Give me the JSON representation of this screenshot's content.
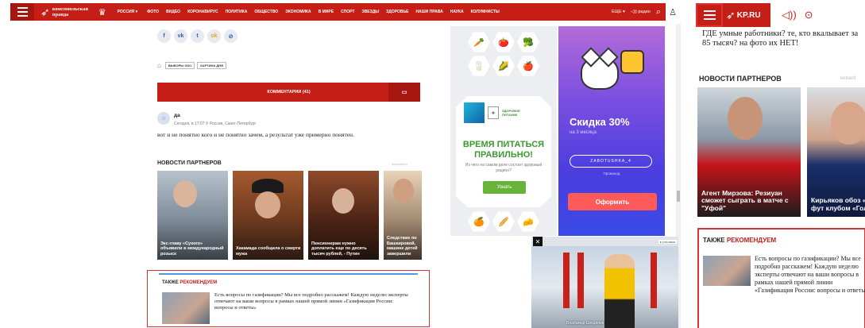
{
  "desktop": {
    "logo_text": "Комсомольская правда",
    "region": "РОССИЯ ▾",
    "nav": [
      "ФОТО",
      "ВИДЕО",
      "КОРОНАВИРУС",
      "ПОЛИТИКА",
      "ОБЩЕСТВО",
      "ЭКОНОМИКА",
      "В МИРЕ",
      "СПОРТ",
      "ЗВЕЗДЫ",
      "ЗДОРОВЬЕ",
      "НАШИ ПРАВА",
      "НАУКА",
      "КОЛУМНИСТЫ"
    ],
    "more": "ЕЩЕ ▾",
    "radio": "◁)) радио",
    "share": [
      "f",
      "vk",
      "t",
      "ok",
      "⊘"
    ],
    "tags": [
      "ВЫБОРЫ 2021",
      "КАРТИНА ДНЯ"
    ],
    "comments_button": "КОММЕНТАРИИ (41)",
    "comment": {
      "author": "да",
      "meta": "Сегодня, в 17:07  ⚲ Россия, Санкт-Петербург",
      "text": "вот и не понятно кого и не понятно зачем, а результат уже примерно понятен."
    },
    "partners_title": "НОВОСТИ ПАРТНЕРОВ",
    "partners_source": "lentainform",
    "partner_cards": [
      "Экс-главу «Сухого» объявили в международный розыск",
      "Хакамада сообщила о смерти мужа",
      "Пенсионерам нужно доплатить еще по десять тысяч рублей, - Путин",
      "Следствие по Башкировой, машине детей завершили"
    ],
    "also": {
      "title_prefix": "ТАКЖЕ ",
      "title_highlight": "РЕКОМЕНДУЕМ",
      "text": "Есть вопросы по газификации? Мы все подробно расскажем! Каждую неделю эксперты отвечают на ваши вопросы в рамках нашей прямой линии «Газификация России: вопросы и ответы»"
    },
    "ad1": {
      "headline": "ВРЕМЯ ПИТАТЬСЯ ПРАВИЛЬНО!",
      "sub": "Из чего на самом деле состоит здоровый рацион?",
      "button": "Узнать",
      "logo_c": "ЗДОРОВОЕ ПИТАНИЕ"
    },
    "ad2": {
      "sale": "Скидка 30%",
      "sale_sub": "на 3 месяца",
      "code": "ZABOTUSHKA_4",
      "promo": "Промокод",
      "button": "Оформить"
    },
    "video": {
      "close": "✕",
      "adlabel": "▸ реклама",
      "name": "Владимир Шещенин"
    }
  },
  "mobile": {
    "logo_text": "KP.RU",
    "intro": "ГДЕ умные работники? те, кто вкалывает за 85 тысяч? на фото их НЕТ!",
    "partners_title": "НОВОСТИ ПАРТНЕРОВ",
    "partners_source": "lentainf",
    "cards": [
      "Агент Мирзова: Резиуан сможет сыграть в матче с \"Уфой\"",
      "Кирьяков обоз «Спартак» фут клубом «Голли"
    ],
    "also": {
      "title_prefix": "ТАКЖЕ ",
      "title_highlight": "РЕКОМЕНДУЕМ",
      "text": "Есть вопросы по газификации? Мы все подробно расскажем! Каждую неделю эксперты отвечают на ваши вопросы в рамках нашей прямой линии «Газификация России: вопросы и ответы»"
    }
  }
}
